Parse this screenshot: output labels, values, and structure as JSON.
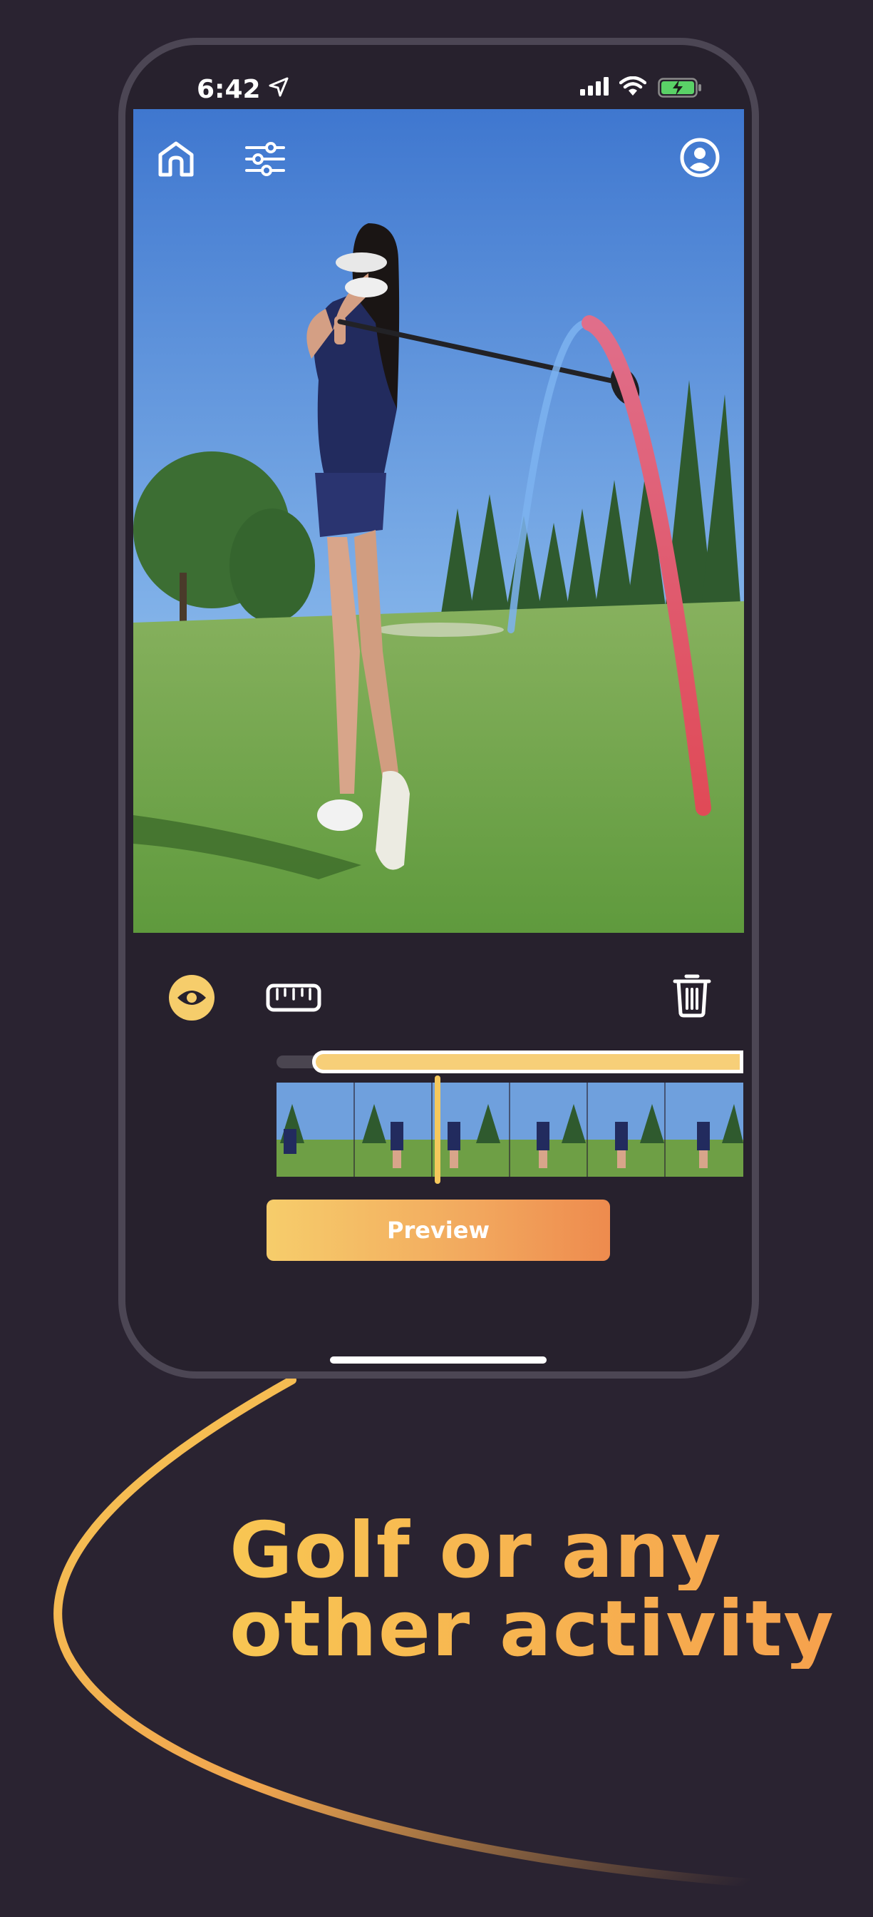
{
  "status_bar": {
    "time": "6:42",
    "icons": [
      "location-arrow-icon",
      "cellular-signal-icon",
      "wifi-icon",
      "battery-charging-icon"
    ]
  },
  "video_toolbar": {
    "icons": [
      "home-icon",
      "sliders-icon",
      "profile-icon"
    ]
  },
  "editor": {
    "icons": [
      "eye-icon",
      "ruler-icon",
      "trash-icon"
    ],
    "trim_range_start": 0.07,
    "trim_range_end": 1.0,
    "playhead_position": 0.34,
    "filmstrip_frame_count": 6,
    "preview_label": "Preview"
  },
  "headline": {
    "line1": "Golf or any",
    "line2": "other activity"
  },
  "colors": {
    "background": "#2a2331",
    "accent_yellow": "#f7cf78",
    "accent_orange": "#ee8b4e",
    "trace_red": "#e04a57",
    "trace_blue": "#7db3f0"
  }
}
